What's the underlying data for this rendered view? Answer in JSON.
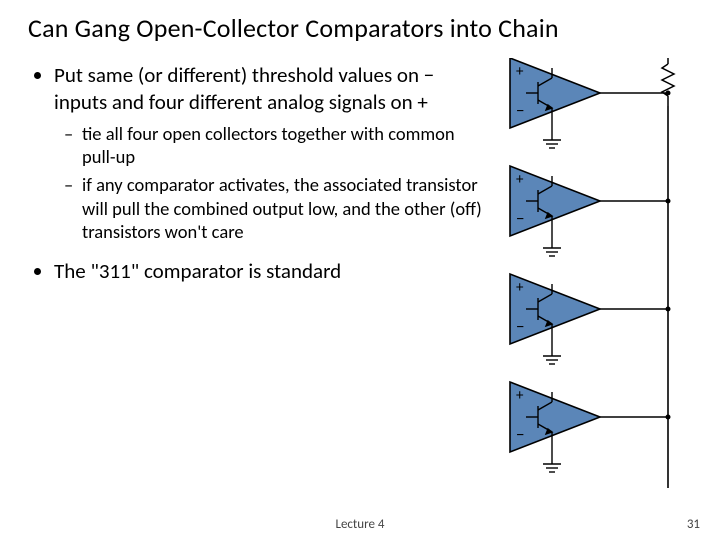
{
  "title": "Can Gang Open-Collector Comparators into Chain",
  "bullets": {
    "b1": "Put same (or different) threshold values on − inputs and four different analog signals on +",
    "b1a": "tie all four open collectors together with common pull-up",
    "b1b": "if any comparator activates, the associated transistor will pull the combined output low, and the other (off) transistors won't care",
    "b2": "The \"311\" comparator is standard"
  },
  "symbols": {
    "plus": "+",
    "minus": "−"
  },
  "footer": {
    "lecture": "Lecture 4",
    "page": "31"
  }
}
